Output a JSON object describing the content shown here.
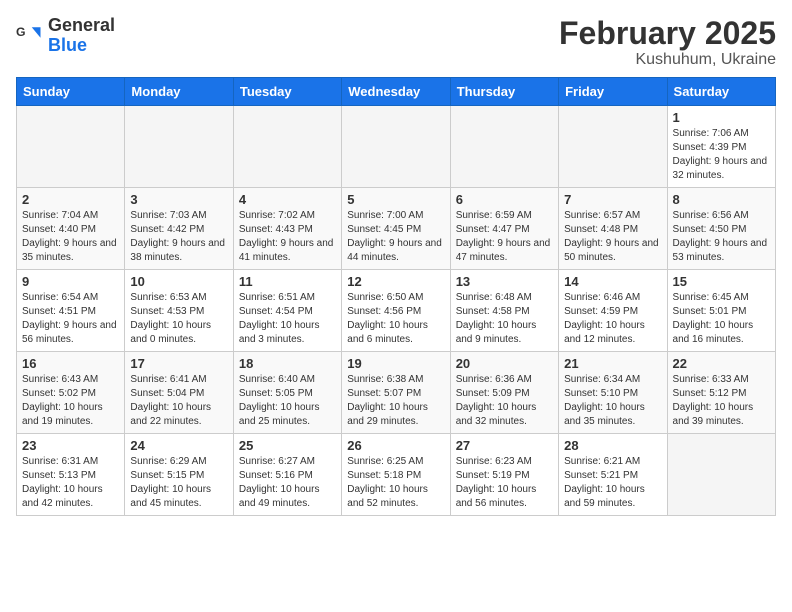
{
  "header": {
    "logo_general": "General",
    "logo_blue": "Blue",
    "month": "February 2025",
    "location": "Kushuhum, Ukraine"
  },
  "weekdays": [
    "Sunday",
    "Monday",
    "Tuesday",
    "Wednesday",
    "Thursday",
    "Friday",
    "Saturday"
  ],
  "weeks": [
    [
      {
        "day": "",
        "info": ""
      },
      {
        "day": "",
        "info": ""
      },
      {
        "day": "",
        "info": ""
      },
      {
        "day": "",
        "info": ""
      },
      {
        "day": "",
        "info": ""
      },
      {
        "day": "",
        "info": ""
      },
      {
        "day": "1",
        "info": "Sunrise: 7:06 AM\nSunset: 4:39 PM\nDaylight: 9 hours and 32 minutes."
      }
    ],
    [
      {
        "day": "2",
        "info": "Sunrise: 7:04 AM\nSunset: 4:40 PM\nDaylight: 9 hours and 35 minutes."
      },
      {
        "day": "3",
        "info": "Sunrise: 7:03 AM\nSunset: 4:42 PM\nDaylight: 9 hours and 38 minutes."
      },
      {
        "day": "4",
        "info": "Sunrise: 7:02 AM\nSunset: 4:43 PM\nDaylight: 9 hours and 41 minutes."
      },
      {
        "day": "5",
        "info": "Sunrise: 7:00 AM\nSunset: 4:45 PM\nDaylight: 9 hours and 44 minutes."
      },
      {
        "day": "6",
        "info": "Sunrise: 6:59 AM\nSunset: 4:47 PM\nDaylight: 9 hours and 47 minutes."
      },
      {
        "day": "7",
        "info": "Sunrise: 6:57 AM\nSunset: 4:48 PM\nDaylight: 9 hours and 50 minutes."
      },
      {
        "day": "8",
        "info": "Sunrise: 6:56 AM\nSunset: 4:50 PM\nDaylight: 9 hours and 53 minutes."
      }
    ],
    [
      {
        "day": "9",
        "info": "Sunrise: 6:54 AM\nSunset: 4:51 PM\nDaylight: 9 hours and 56 minutes."
      },
      {
        "day": "10",
        "info": "Sunrise: 6:53 AM\nSunset: 4:53 PM\nDaylight: 10 hours and 0 minutes."
      },
      {
        "day": "11",
        "info": "Sunrise: 6:51 AM\nSunset: 4:54 PM\nDaylight: 10 hours and 3 minutes."
      },
      {
        "day": "12",
        "info": "Sunrise: 6:50 AM\nSunset: 4:56 PM\nDaylight: 10 hours and 6 minutes."
      },
      {
        "day": "13",
        "info": "Sunrise: 6:48 AM\nSunset: 4:58 PM\nDaylight: 10 hours and 9 minutes."
      },
      {
        "day": "14",
        "info": "Sunrise: 6:46 AM\nSunset: 4:59 PM\nDaylight: 10 hours and 12 minutes."
      },
      {
        "day": "15",
        "info": "Sunrise: 6:45 AM\nSunset: 5:01 PM\nDaylight: 10 hours and 16 minutes."
      }
    ],
    [
      {
        "day": "16",
        "info": "Sunrise: 6:43 AM\nSunset: 5:02 PM\nDaylight: 10 hours and 19 minutes."
      },
      {
        "day": "17",
        "info": "Sunrise: 6:41 AM\nSunset: 5:04 PM\nDaylight: 10 hours and 22 minutes."
      },
      {
        "day": "18",
        "info": "Sunrise: 6:40 AM\nSunset: 5:05 PM\nDaylight: 10 hours and 25 minutes."
      },
      {
        "day": "19",
        "info": "Sunrise: 6:38 AM\nSunset: 5:07 PM\nDaylight: 10 hours and 29 minutes."
      },
      {
        "day": "20",
        "info": "Sunrise: 6:36 AM\nSunset: 5:09 PM\nDaylight: 10 hours and 32 minutes."
      },
      {
        "day": "21",
        "info": "Sunrise: 6:34 AM\nSunset: 5:10 PM\nDaylight: 10 hours and 35 minutes."
      },
      {
        "day": "22",
        "info": "Sunrise: 6:33 AM\nSunset: 5:12 PM\nDaylight: 10 hours and 39 minutes."
      }
    ],
    [
      {
        "day": "23",
        "info": "Sunrise: 6:31 AM\nSunset: 5:13 PM\nDaylight: 10 hours and 42 minutes."
      },
      {
        "day": "24",
        "info": "Sunrise: 6:29 AM\nSunset: 5:15 PM\nDaylight: 10 hours and 45 minutes."
      },
      {
        "day": "25",
        "info": "Sunrise: 6:27 AM\nSunset: 5:16 PM\nDaylight: 10 hours and 49 minutes."
      },
      {
        "day": "26",
        "info": "Sunrise: 6:25 AM\nSunset: 5:18 PM\nDaylight: 10 hours and 52 minutes."
      },
      {
        "day": "27",
        "info": "Sunrise: 6:23 AM\nSunset: 5:19 PM\nDaylight: 10 hours and 56 minutes."
      },
      {
        "day": "28",
        "info": "Sunrise: 6:21 AM\nSunset: 5:21 PM\nDaylight: 10 hours and 59 minutes."
      },
      {
        "day": "",
        "info": ""
      }
    ]
  ]
}
